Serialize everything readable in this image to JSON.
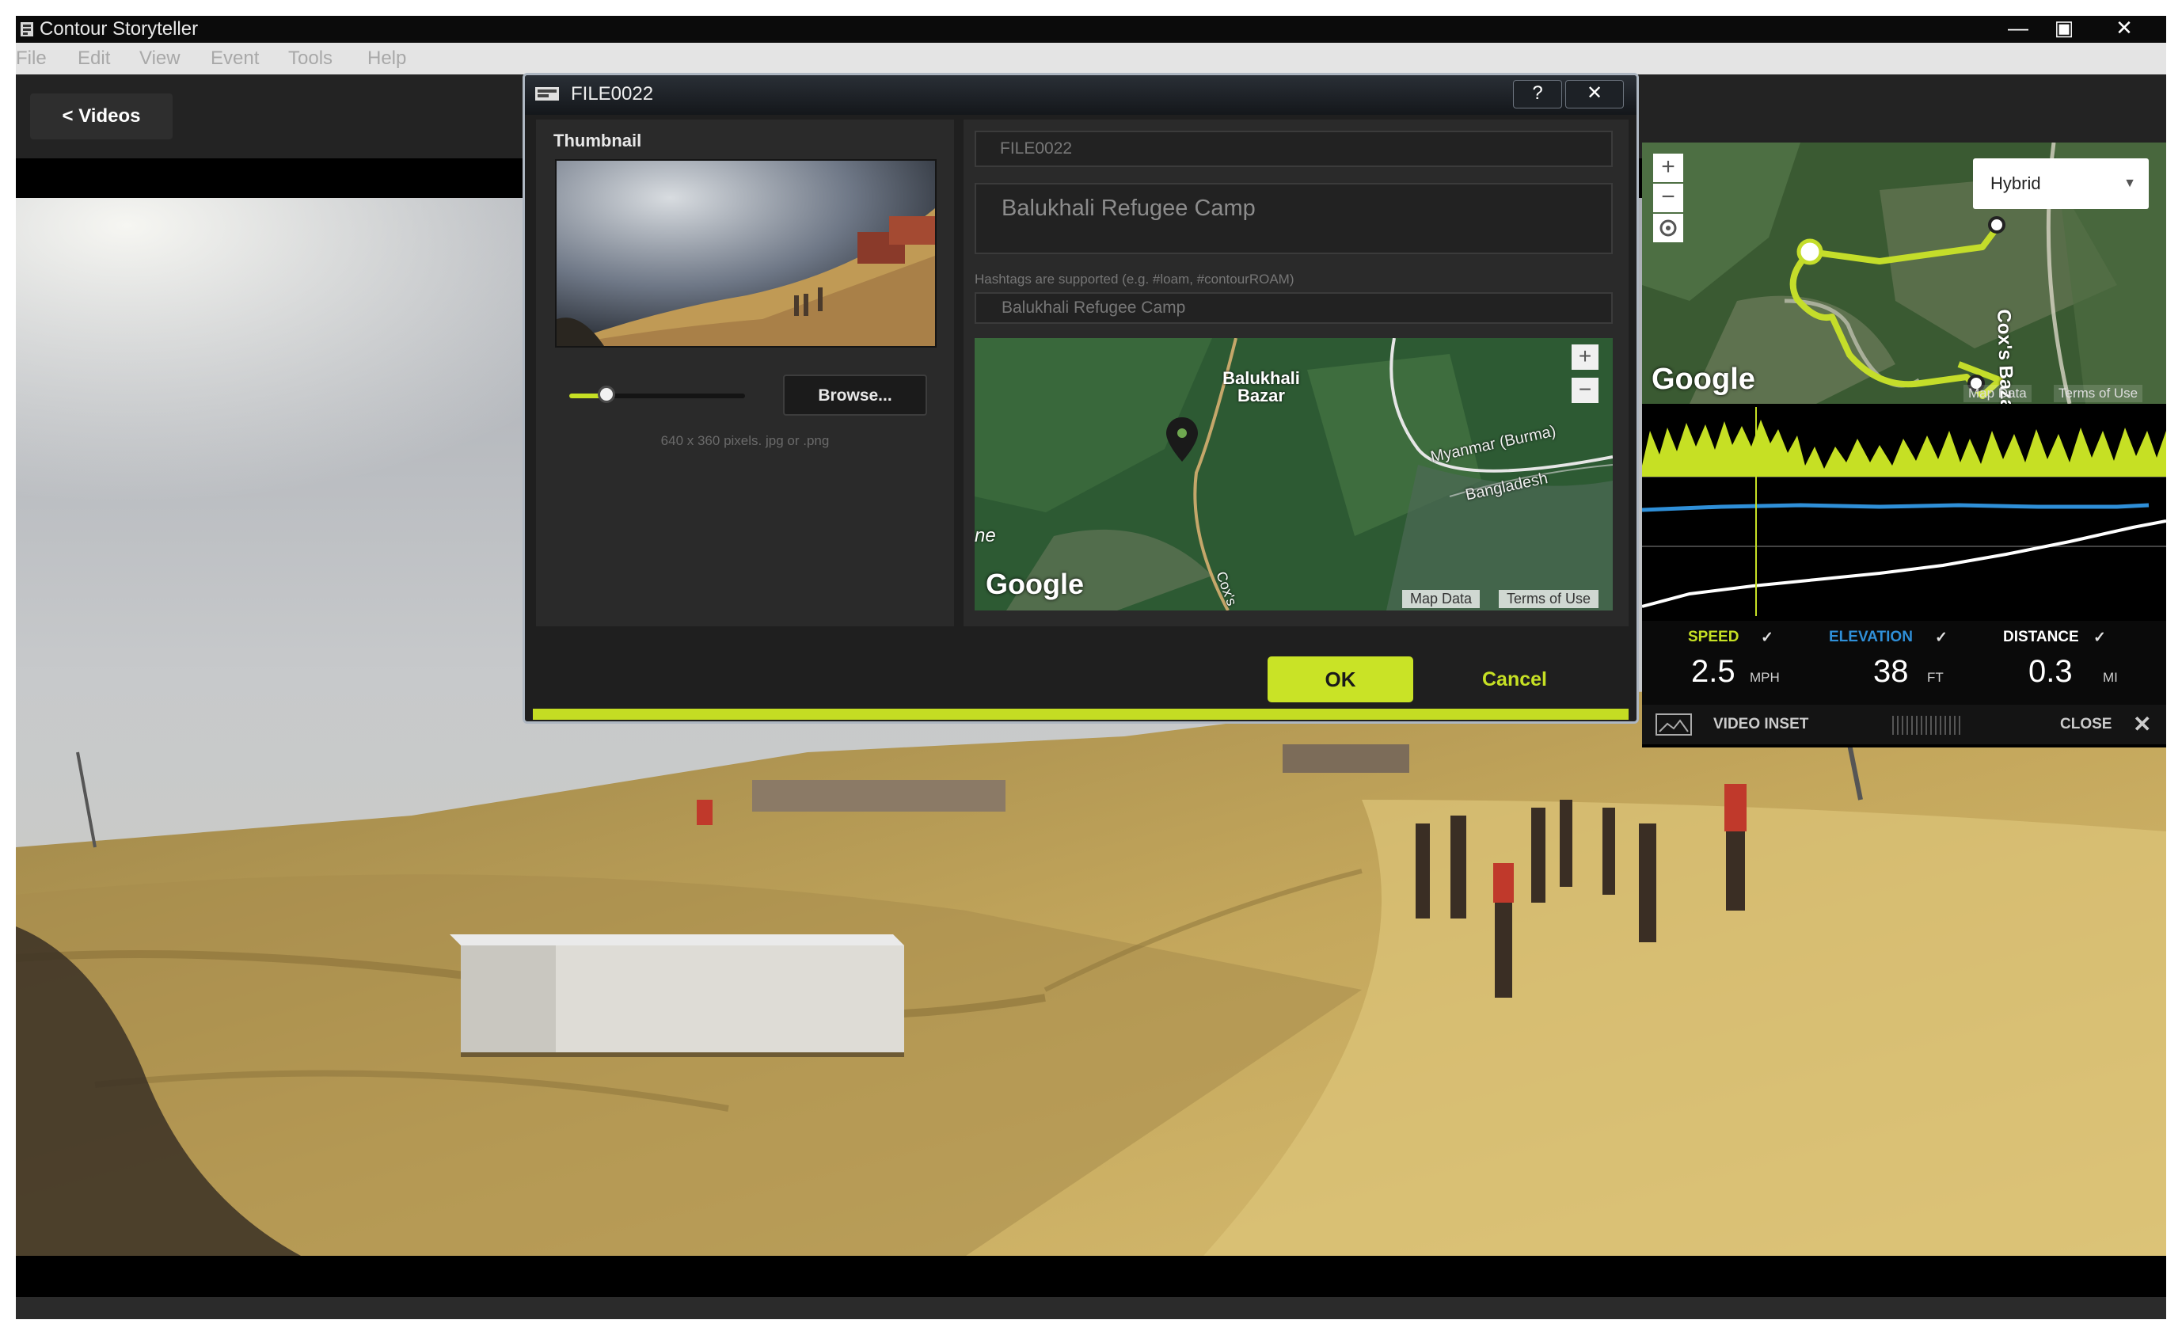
{
  "window": {
    "title": "Contour Storyteller",
    "controls": {
      "minimize": "—",
      "restore": "▣",
      "close": "✕"
    }
  },
  "menu": [
    "File",
    "Edit",
    "View",
    "Event",
    "Tools",
    "Help"
  ],
  "toolbar": {
    "back_label": "< Videos"
  },
  "dialog": {
    "title": "FILE0022",
    "help_label": "?",
    "close_label": "✕",
    "thumbnail_label": "Thumbnail",
    "browse_label": "Browse...",
    "size_hint": "640 x 360 pixels. jpg or .png",
    "name_value": "FILE0022",
    "description_value": "Balukhali Refugee Camp",
    "hashtag_hint": "Hashtags are supported (e.g. #loam, #contourROAM)",
    "tags_value": "Balukhali Refugee Camp",
    "ok_label": "OK",
    "cancel_label": "Cancel",
    "thumbnail_slider": 0.18,
    "map": {
      "place_label": "Balukhali Bazar",
      "border_label_1": "Myanmar (Burma)",
      "border_label_2": "Bangladesh",
      "road_label": "Cox's",
      "edge_label": "ne",
      "google": "Google",
      "map_data": "Map Data",
      "terms": "Terms of Use",
      "zoom_in": "+",
      "zoom_out": "−"
    }
  },
  "telemetry": {
    "map": {
      "type_select": "Hybrid",
      "google": "Google",
      "road_label": "Cox's Bazar",
      "map_data": "Map Data",
      "terms": "Terms of Use",
      "zoom_in": "+",
      "zoom_out": "−"
    },
    "metrics": [
      {
        "label": "SPEED",
        "value": "2.5",
        "unit": "MPH",
        "color": "#c6e024"
      },
      {
        "label": "ELEVATION",
        "value": "38",
        "unit": "FT",
        "color": "#2f8fd8"
      },
      {
        "label": "DISTANCE",
        "value": "0.3",
        "unit": "MI",
        "color": "#ffffff"
      }
    ],
    "check": "✓",
    "video_inset_label": "VIDEO INSET",
    "close_label": "CLOSE",
    "close_icon": "✕"
  },
  "colors": {
    "accent": "#c6e024",
    "elevation": "#2f8fd8"
  }
}
